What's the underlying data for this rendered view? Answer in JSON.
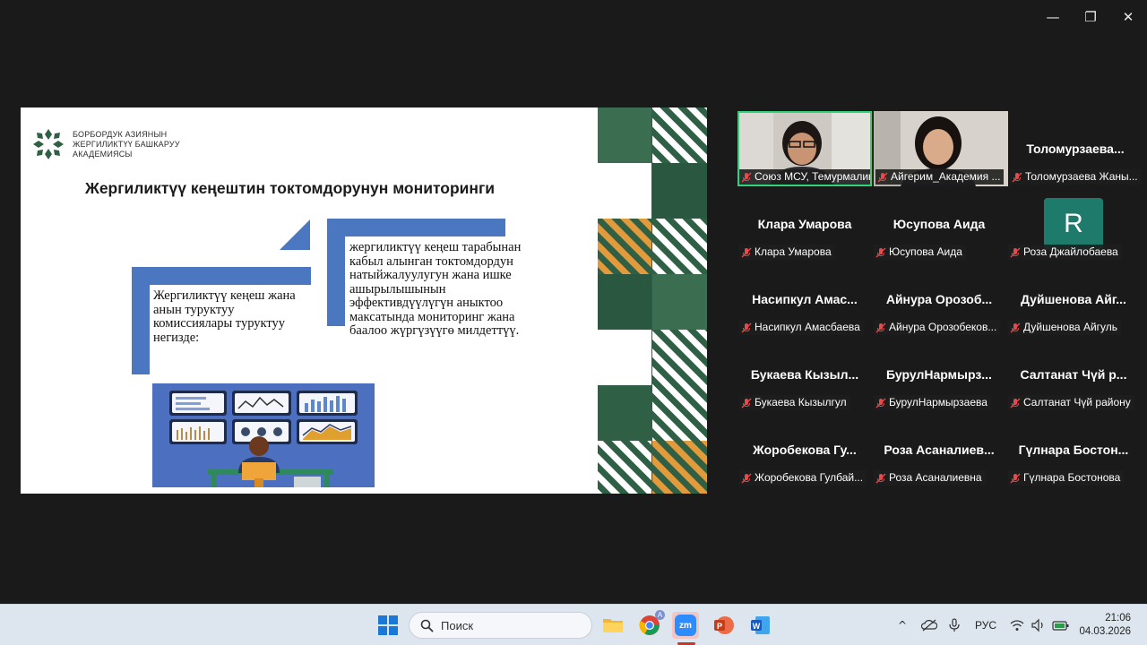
{
  "window": {
    "controls": {
      "minimize": "—",
      "restore": "❐",
      "close": "✕"
    }
  },
  "slide": {
    "logo_lines": [
      "БОРБОРДУК АЗИЯНЫН",
      "ЖЕРГИЛИКТҮҮ БАШКАРУУ",
      "АКАДЕМИЯСЫ"
    ],
    "title": "Жергиликтүү кеңештин токтомдорунун мониторинги",
    "left_box_text": "Жергиликтүү кеңеш жана анын туруктуу комиссиялары туруктуу негизде:",
    "right_box_text": "жергиликтүү кеңеш тарабынан кабыл алынган токтомдордун натыйжалуулугун жана ишке ашырылышынын эффективдүүлүгүн аныктоо максатында мониторинг жана баалоо жүргүзүүгө милдеттүү."
  },
  "participants": [
    {
      "name": "",
      "label": "Союз МСУ, Темурмалик...",
      "type": "video",
      "active": true
    },
    {
      "name": "",
      "label": "Айгерим_Академия ...",
      "type": "video",
      "active": false
    },
    {
      "name": "Толомурзаева...",
      "label": "Толомурзаева Жаны...",
      "type": "name"
    },
    {
      "name": "Клара Умарова",
      "label": "Клара Умарова",
      "type": "name"
    },
    {
      "name": "Юсупова Аида",
      "label": "Юсупова Аида",
      "type": "name"
    },
    {
      "name": "R",
      "label": "Роза Джайлобаева",
      "type": "avatar"
    },
    {
      "name": "Насипкул Амас...",
      "label": "Насипкул Амасбаева",
      "type": "name"
    },
    {
      "name": "Айнура Орозоб...",
      "label": "Айнура Орозобеков...",
      "type": "name"
    },
    {
      "name": "Дуйшенова Айг...",
      "label": "Дуйшенова Айгуль",
      "type": "name"
    },
    {
      "name": "Букаева Кызыл...",
      "label": "Букаева Кызылгул",
      "type": "name"
    },
    {
      "name": "БурулНармырз...",
      "label": "БурулНармырзаева",
      "type": "name"
    },
    {
      "name": "Салтанат Чүй р...",
      "label": "Салтанат Чүй району",
      "type": "name"
    },
    {
      "name": "Жоробекова Гу...",
      "label": "Жоробекова Гулбай...",
      "type": "name"
    },
    {
      "name": "Роза Асаналиев...",
      "label": "Роза Асаналиевна",
      "type": "name"
    },
    {
      "name": "Гүлнара Бостон...",
      "label": "Гүлнара Бостонова",
      "type": "name"
    }
  ],
  "taskbar": {
    "search_placeholder": "Поиск",
    "language": "РУС",
    "time": "21:06",
    "date": "04.03.2026",
    "apps": [
      "start-icon",
      "search-icon",
      "file-explorer-icon",
      "chrome-icon",
      "zoom-icon",
      "powerpoint-icon",
      "word-icon"
    ],
    "chrome_badge": "A",
    "zoom_label": "zm"
  },
  "colors": {
    "accent_blue": "#4a77c0",
    "green_dark": "#2f5f45",
    "orange": "#e39a3b",
    "active_speaker": "#2fd37a",
    "mic_muted": "#e64a4a"
  }
}
